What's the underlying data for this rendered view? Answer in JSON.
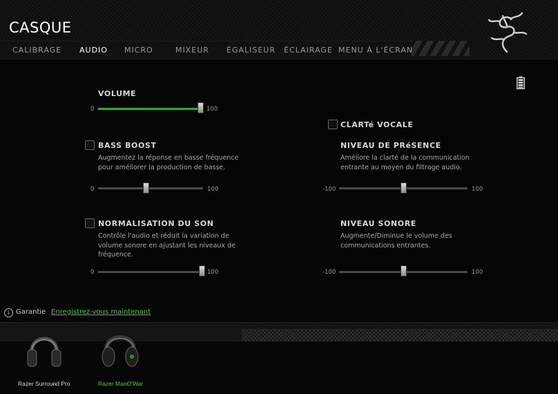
{
  "header": {
    "title": "CASQUE",
    "tabs": [
      {
        "label": "CALIBRAGE",
        "active": false
      },
      {
        "label": "AUDIO",
        "active": true
      },
      {
        "label": "MICRO",
        "active": false
      },
      {
        "label": "MIXEUR",
        "active": false
      },
      {
        "label": "ÉGALISEUR",
        "active": false
      },
      {
        "label": "ÉCLAIRAGE",
        "active": false
      },
      {
        "label": "MENU À L'ÉCRAN",
        "active": false
      }
    ],
    "logo_icon": "razer-snake-logo"
  },
  "battery_icon": "battery-icon",
  "volume": {
    "label": "VOLUME",
    "min": "0",
    "max": "100",
    "value": 100,
    "accent": "#3aa534"
  },
  "bass_boost": {
    "label": "BASS BOOST",
    "checked": false,
    "desc_line1": "Augmentez la réponse en basse fréquence",
    "desc_line2": "pour améliorer la production de basse.",
    "min": "0",
    "max": "100",
    "value": 45
  },
  "normalization": {
    "label": "NORMALISATION DU SON",
    "checked": false,
    "desc_line1": "Contrôle l'audio et réduit la variation de",
    "desc_line2": "volume sonore en ajustant les niveaux de",
    "desc_line3": "fréquence.",
    "min": "0",
    "max": "100",
    "value": 100
  },
  "voice_clarity": {
    "label": "CLARTé VOCALE",
    "checked": false
  },
  "presence": {
    "label": "NIVEAU DE PRéSENCE",
    "desc_line1": "Améliore la clarté de la communication",
    "desc_line2": "entrante au moyen du filtrage audio.",
    "min": "-100",
    "max": "100",
    "value": 0
  },
  "sound_level": {
    "label": "NIVEAU SONORE",
    "desc_line1": "Augmente/Diminue le volume des",
    "desc_line2": "communications entrantes.",
    "min": "-100",
    "max": "100",
    "value": 0
  },
  "warranty": {
    "label": "Garantie",
    "link": "Enregistrez-vous maintenant",
    "link_color": "#3ecf2c"
  },
  "devices": [
    {
      "name": "Razer Surround Pro",
      "selected": false,
      "color": "#ffffff"
    },
    {
      "name": "Razer ManO'War",
      "selected": true,
      "color": "#3ecf2c"
    }
  ]
}
